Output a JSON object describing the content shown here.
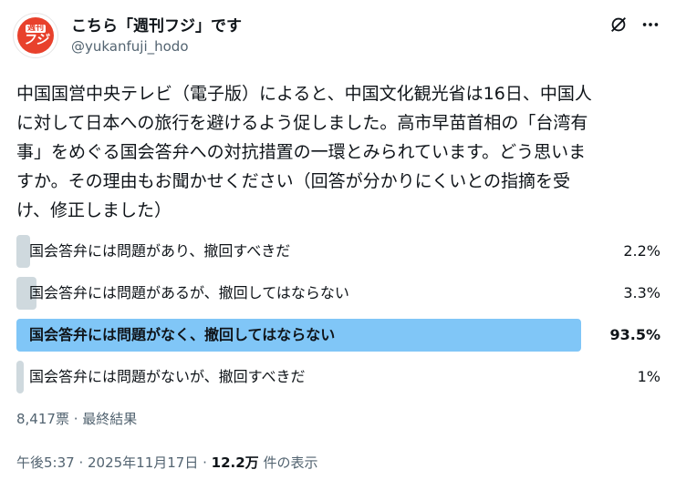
{
  "header": {
    "display_name": "こちら「週刊フジ」です",
    "handle": "@yukanfuji_hodo",
    "avatar": {
      "top_text": "週刊",
      "bottom_text": "フジ"
    }
  },
  "icons": {
    "grok": "grok-icon",
    "more": "more-icon"
  },
  "tweet": {
    "text": "中国国営中央テレビ（電子版）によると、中国文化観光省は16日、中国人\nに対して日本への旅行を避けるよう促しました。高市早苗首相の「台湾有\n事」をめぐる国会答弁への対抗措置の一環とみられています。どう思いま\nすか。その理由もお聞かせください（回答が分かりにくいとの指摘を受\nけ、修正しました）"
  },
  "poll": {
    "options": [
      {
        "label": "国会答弁には問題があり、撤回すべきだ",
        "percent_text": "2.2%",
        "percent": 2.2,
        "winner": false
      },
      {
        "label": "国会答弁には問題があるが、撤回してはならない",
        "percent_text": "3.3%",
        "percent": 3.3,
        "winner": false
      },
      {
        "label": "国会答弁には問題がなく、撤回してはならない",
        "percent_text": "93.5%",
        "percent": 93.5,
        "winner": true
      },
      {
        "label": "国会答弁には問題がないが、撤回すべきだ",
        "percent_text": "1%",
        "percent": 1,
        "winner": false
      }
    ],
    "footer": "8,417票 · 最終結果"
  },
  "meta": {
    "timestamp": "午後5:37 · 2025年11月17日 · ",
    "views_count": "12.2万",
    "views_label": " 件の表示"
  },
  "colors": {
    "winner_bar": "#80c6f7",
    "bar": "#cfd9de",
    "muted_text": "#536471"
  }
}
